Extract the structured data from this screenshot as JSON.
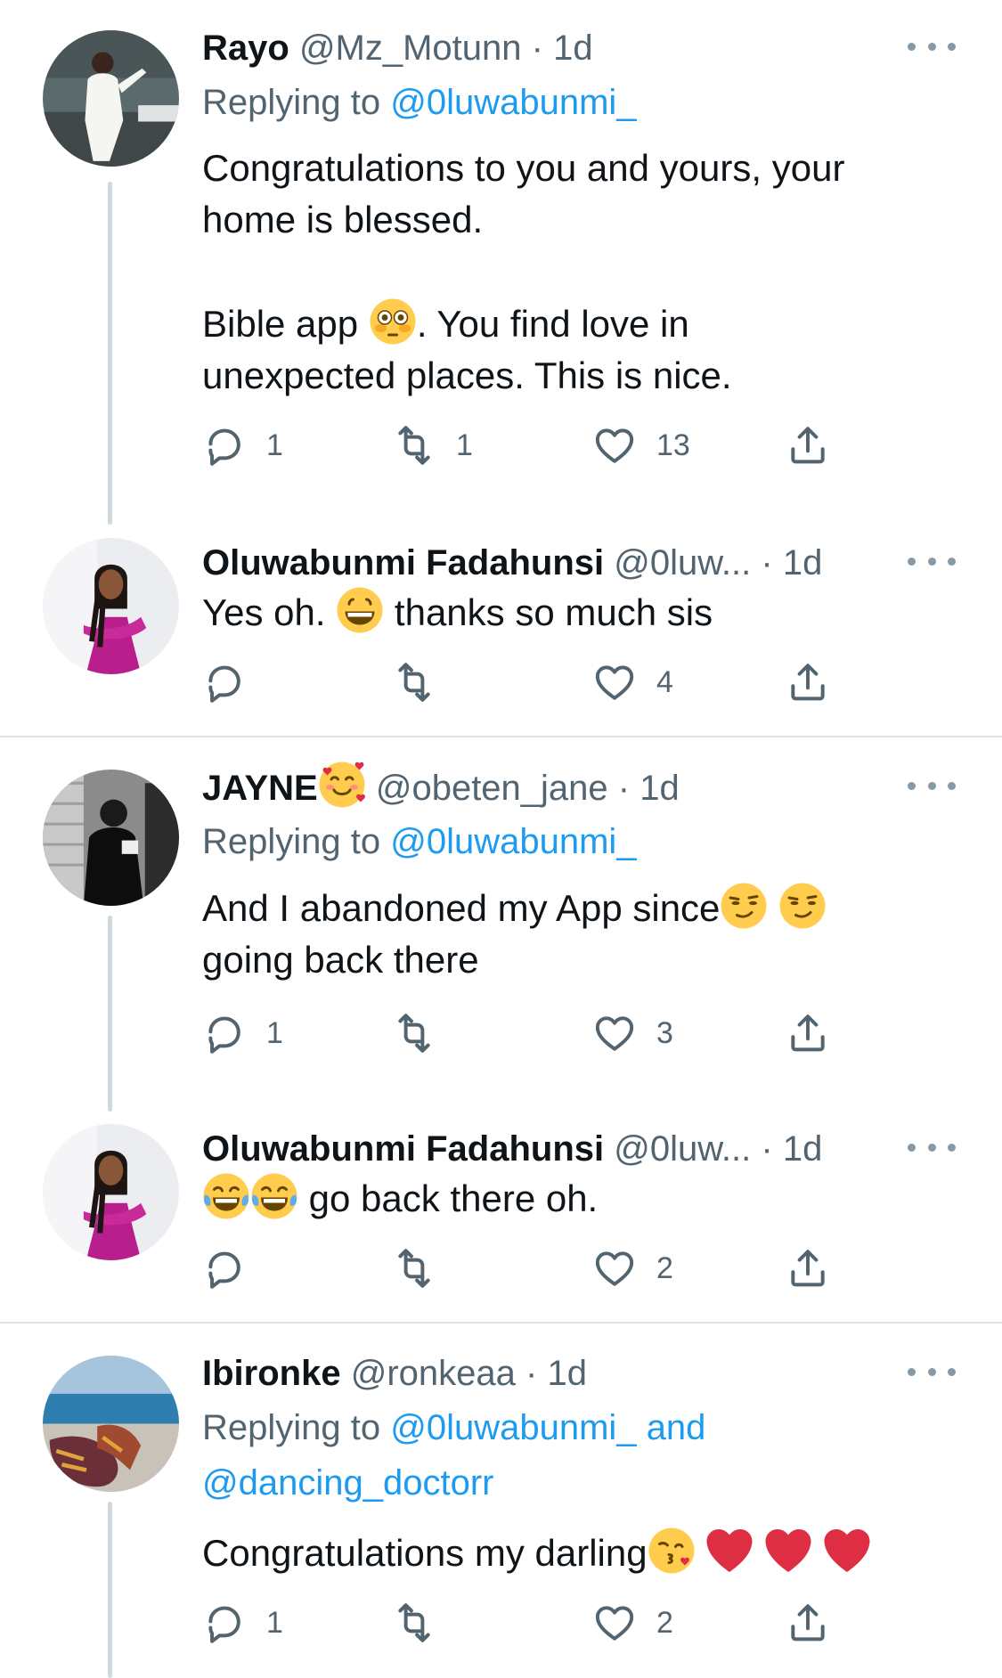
{
  "tweets": [
    {
      "name": "Rayo",
      "handle": "@Mz_Motunn",
      "dot": "·",
      "time": "1d",
      "replying_label": "Replying to",
      "replying_to": "@0luwabunmi_",
      "body_line1": "Congratulations to you and yours, your",
      "body_line2": "home is blessed.",
      "body_line3a": "Bible app",
      "body_emoji1": "flushed-face-emoji",
      "body_line3b": ". You find love in",
      "body_line4": "unexpected places. This is nice.",
      "reply_count": "1",
      "retweet_count": "1",
      "like_count": "13"
    },
    {
      "name": "Oluwabunmi Fadahunsi",
      "handle": "@0luw...",
      "dot": "·",
      "time": "1d",
      "body_a": "Yes oh.",
      "body_emoji1": "grinning-face-emoji",
      "body_b": "thanks so much sis",
      "reply_count": "",
      "retweet_count": "",
      "like_count": "4"
    },
    {
      "name": "JAYNE",
      "name_emoji": "smiling-face-with-hearts-emoji",
      "handle": "@obeten_jane",
      "dot": "·",
      "time": "1d",
      "replying_label": "Replying to",
      "replying_to": "@0luwabunmi_",
      "body_line1": "And I abandoned my App since",
      "body_emoji1": "smirking-face-emoji",
      "body_emoji2": "smirking-face-emoji",
      "body_line2": "going back there",
      "reply_count": "1",
      "retweet_count": "",
      "like_count": "3"
    },
    {
      "name": "Oluwabunmi Fadahunsi",
      "handle": "@0luw...",
      "dot": "·",
      "time": "1d",
      "body_emoji1": "tears-of-joy-emoji",
      "body_emoji2": "tears-of-joy-emoji",
      "body_a": "go back there oh.",
      "reply_count": "",
      "retweet_count": "",
      "like_count": "2"
    },
    {
      "name": "Ibironke",
      "handle": "@ronkeaa",
      "dot": "·",
      "time": "1d",
      "replying_label": "Replying to",
      "replying_to_1": "@0luwabunmi_",
      "replying_and": "and",
      "replying_to_2": "@dancing_doctorr",
      "body_a": "Congratulations my darling",
      "body_emoji1": "face-blowing-kiss-emoji",
      "body_emoji2": "red-heart-emoji",
      "body_emoji3": "red-heart-emoji",
      "body_emoji4": "red-heart-emoji",
      "reply_count": "1",
      "retweet_count": "",
      "like_count": "2"
    }
  ],
  "colors": {
    "text": "#0f1419",
    "secondary": "#536471",
    "link": "#1d9bf0",
    "thread_line": "#cfd9de",
    "divider": "#e1e5e8"
  },
  "icons": {
    "reply": "reply-icon",
    "retweet": "retweet-icon",
    "like": "heart-icon",
    "share": "share-icon",
    "more": "more-options-icon"
  }
}
